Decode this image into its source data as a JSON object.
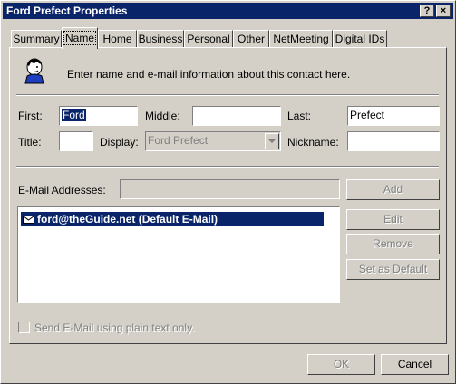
{
  "window": {
    "title": "Ford Prefect Properties",
    "help_button": "?",
    "close_button": "×"
  },
  "tabs": [
    {
      "label": "Summary"
    },
    {
      "label": "Name",
      "active": true
    },
    {
      "label": "Home"
    },
    {
      "label": "Business"
    },
    {
      "label": "Personal"
    },
    {
      "label": "Other"
    },
    {
      "label": "NetMeeting"
    },
    {
      "label": "Digital IDs"
    }
  ],
  "header": {
    "icon": "contact-person-icon",
    "description": "Enter name and e-mail information about this contact here."
  },
  "name": {
    "first_label": "First:",
    "first_value": "Ford",
    "middle_label": "Middle:",
    "middle_value": "",
    "last_label": "Last:",
    "last_value": "Prefect",
    "title_label": "Title:",
    "title_value": "",
    "display_label": "Display:",
    "display_value": "Ford Prefect",
    "nickname_label": "Nickname:",
    "nickname_value": ""
  },
  "email": {
    "label": "E-Mail Addresses:",
    "input_value": "",
    "add_button": "Add",
    "items": [
      {
        "address": "ford@theGuide.net  (Default E-Mail)",
        "selected": true
      }
    ],
    "edit_button": "Edit",
    "remove_button": "Remove",
    "set_default_button": "Set as Default",
    "plain_text_label": "Send E-Mail using plain text only."
  },
  "footer": {
    "ok_button": "OK",
    "cancel_button": "Cancel"
  },
  "colors": {
    "face": "#d4d0c8",
    "titlebar": "#0a246a",
    "selection": "#0a246a"
  }
}
